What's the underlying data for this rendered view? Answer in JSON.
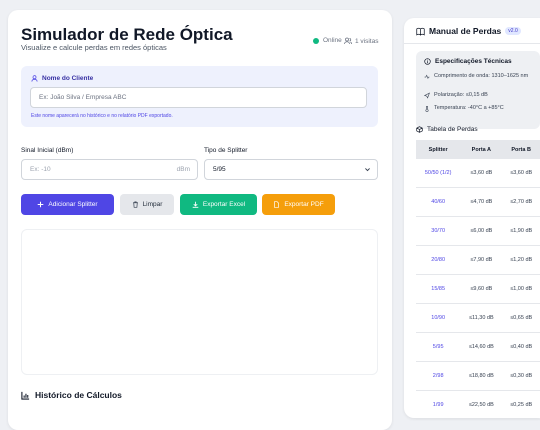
{
  "header": {
    "title": "Simulador de Rede Óptica",
    "subtitle": "Visualize e calcule perdas em redes ópticas",
    "status": "Online",
    "visits": "1 visitas"
  },
  "client": {
    "label": "Nome do Cliente",
    "placeholder": "Ex: João Silva / Empresa ABC",
    "hint": "Este nome aparecerá no histórico e no relatório PDF exportado."
  },
  "signal": {
    "label": "Sinal Inicial (dBm)",
    "placeholder": "Ex: -10",
    "unit": "dBm"
  },
  "splitter": {
    "label": "Tipo de Splitter",
    "selected": "5/95"
  },
  "buttons": {
    "add": "Adicionar Splitter",
    "clear": "Limpar",
    "excel": "Exportar Excel",
    "pdf": "Exportar PDF"
  },
  "history": {
    "title": "Histórico de Cálculos"
  },
  "manual": {
    "title": "Manual de Perdas",
    "version": "v2.0",
    "specs_title": "Especificações Técnicas",
    "specs": [
      "Comprimento de onda: 1310–1625 nm",
      "Polarização: ≤0,15 dB",
      "Temperatura: -40°C a +85°C"
    ],
    "table_title": "Tabela de Perdas",
    "columns": [
      "Splitter",
      "Porta A",
      "Porta B"
    ],
    "rows": [
      {
        "splitter": "50/50 (1/2)",
        "a": "≤3,60 dB",
        "b": "≤3,60 dB"
      },
      {
        "splitter": "40/60",
        "a": "≤4,70 dB",
        "b": "≤2,70 dB"
      },
      {
        "splitter": "30/70",
        "a": "≤6,00 dB",
        "b": "≤1,90 dB"
      },
      {
        "splitter": "20/80",
        "a": "≤7,90 dB",
        "b": "≤1,20 dB"
      },
      {
        "splitter": "15/85",
        "a": "≤9,60 dB",
        "b": "≤1,00 dB"
      },
      {
        "splitter": "10/90",
        "a": "≤11,30 dB",
        "b": "≤0,65 dB"
      },
      {
        "splitter": "5/95",
        "a": "≤14,60 dB",
        "b": "≤0,40 dB"
      },
      {
        "splitter": "2/98",
        "a": "≤18,80 dB",
        "b": "≤0,30 dB"
      },
      {
        "splitter": "1/99",
        "a": "≤22,50 dB",
        "b": "≤0,25 dB"
      }
    ]
  },
  "colors": {
    "primary": "#4f46e5",
    "success": "#10b981",
    "warning": "#f59e0b",
    "neutral": "#e5e7eb"
  }
}
